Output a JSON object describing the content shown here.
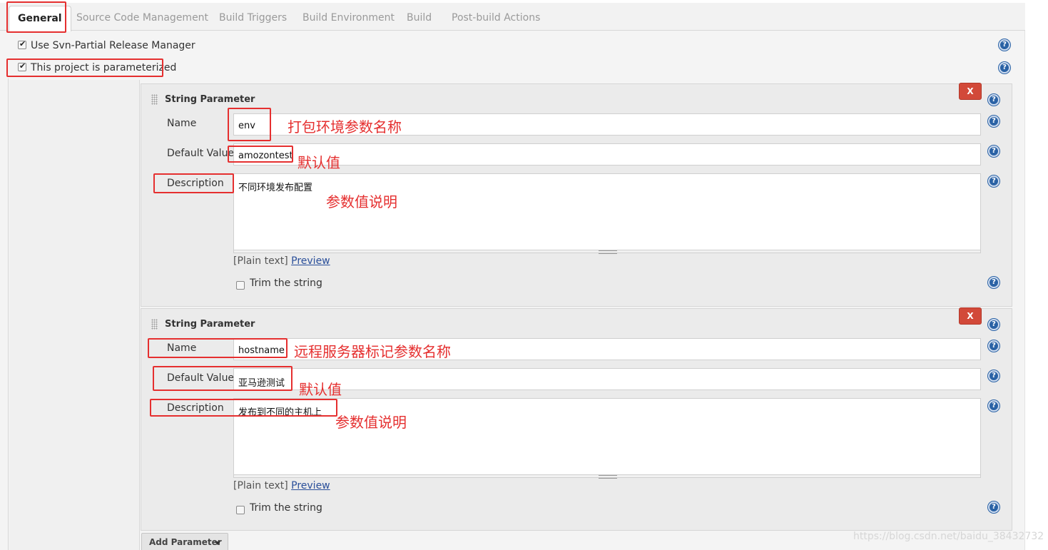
{
  "tabs": {
    "general": "General",
    "scm": "Source Code Management",
    "triggers": "Build Triggers",
    "environment": "Build Environment",
    "build": "Build",
    "post_build": "Post-build Actions"
  },
  "general": {
    "svn_partial": "Use Svn-Partial Release Manager",
    "parameterized": "This project is parameterized"
  },
  "params": [
    {
      "title": "String Parameter",
      "delete_label": "X",
      "name_label": "Name",
      "name_value": "env",
      "default_label": "Default Value",
      "default_value": "amozontest",
      "description_label": "Description",
      "description_value": "不同环境发布配置",
      "format_prefix": "[Plain text]",
      "preview_link": "Preview",
      "trim_label": "Trim the string",
      "annotations": {
        "name": "打包环境参数名称",
        "default": "默认值",
        "description": "参数值说明"
      }
    },
    {
      "title": "String Parameter",
      "delete_label": "X",
      "name_label": "Name",
      "name_value": "hostname",
      "default_label": "Default Value",
      "default_value": "亚马逊测试",
      "description_label": "Description",
      "description_value": "发布到不同的主机上",
      "format_prefix": "[Plain text]",
      "preview_link": "Preview",
      "trim_label": "Trim the string",
      "annotations": {
        "name": "远程服务器标记参数名称",
        "default": "默认值",
        "description": "参数值说明"
      }
    }
  ],
  "add_parameter_label": "Add Parameter",
  "help_glyph": "?",
  "watermark": "https://blog.csdn.net/baidu_38432732",
  "colors": {
    "annotation": "#e52f2f",
    "delete_button": "#d24939",
    "help_icon": "#2a62a5",
    "link": "#2a4f9a"
  },
  "icons": [
    "help-icon",
    "drag-handle-icon",
    "checkbox-checked-icon",
    "checkbox-unchecked-icon",
    "dropdown-caret-icon"
  ]
}
